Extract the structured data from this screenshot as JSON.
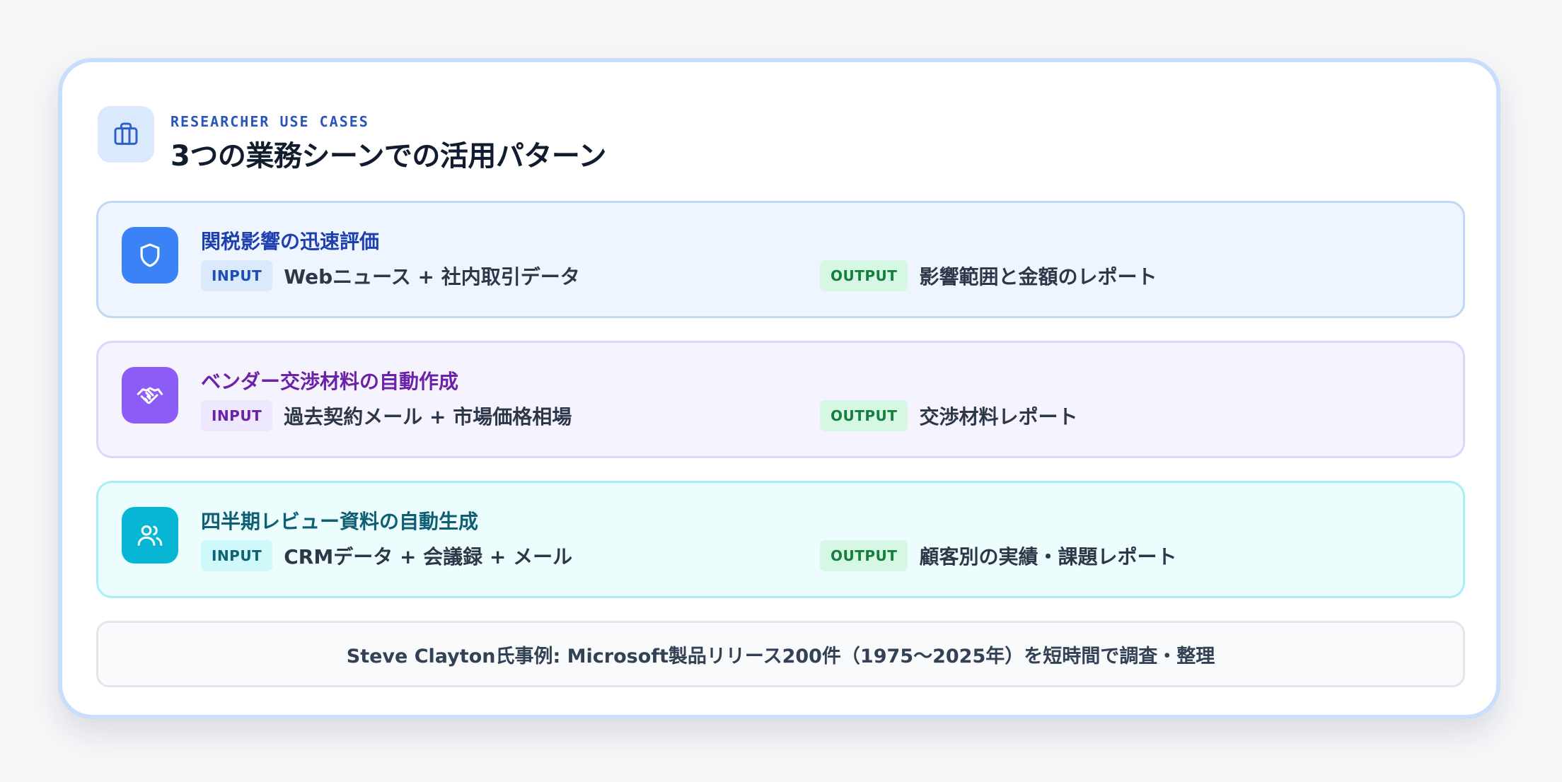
{
  "header": {
    "icon": "briefcase-icon",
    "eyebrow": "RESEARCHER USE CASES",
    "title": "3つの業務シーンでの活用パターン"
  },
  "cases": [
    {
      "icon": "shield-icon",
      "accent": "#3b82f6",
      "title": "関税影響の迅速評価",
      "input_label": "INPUT",
      "input": "Webニュース + 社内取引データ",
      "output_label": "OUTPUT",
      "output": "影響範囲と金額のレポート"
    },
    {
      "icon": "handshake-icon",
      "accent": "#8b5cf6",
      "title": "ベンダー交渉材料の自動作成",
      "input_label": "INPUT",
      "input": "過去契約メール + 市場価格相場",
      "output_label": "OUTPUT",
      "output": "交渉材料レポート"
    },
    {
      "icon": "users-icon",
      "accent": "#06b6d4",
      "title": "四半期レビュー資料の自動生成",
      "input_label": "INPUT",
      "input": "CRMデータ + 会議録 + メール",
      "output_label": "OUTPUT",
      "output": "顧客別の実績・課題レポート"
    }
  ],
  "footer": {
    "text": "Steve Clayton氏事例: Microsoft製品リリース200件（1975〜2025年）を短時間で調査・整理"
  }
}
